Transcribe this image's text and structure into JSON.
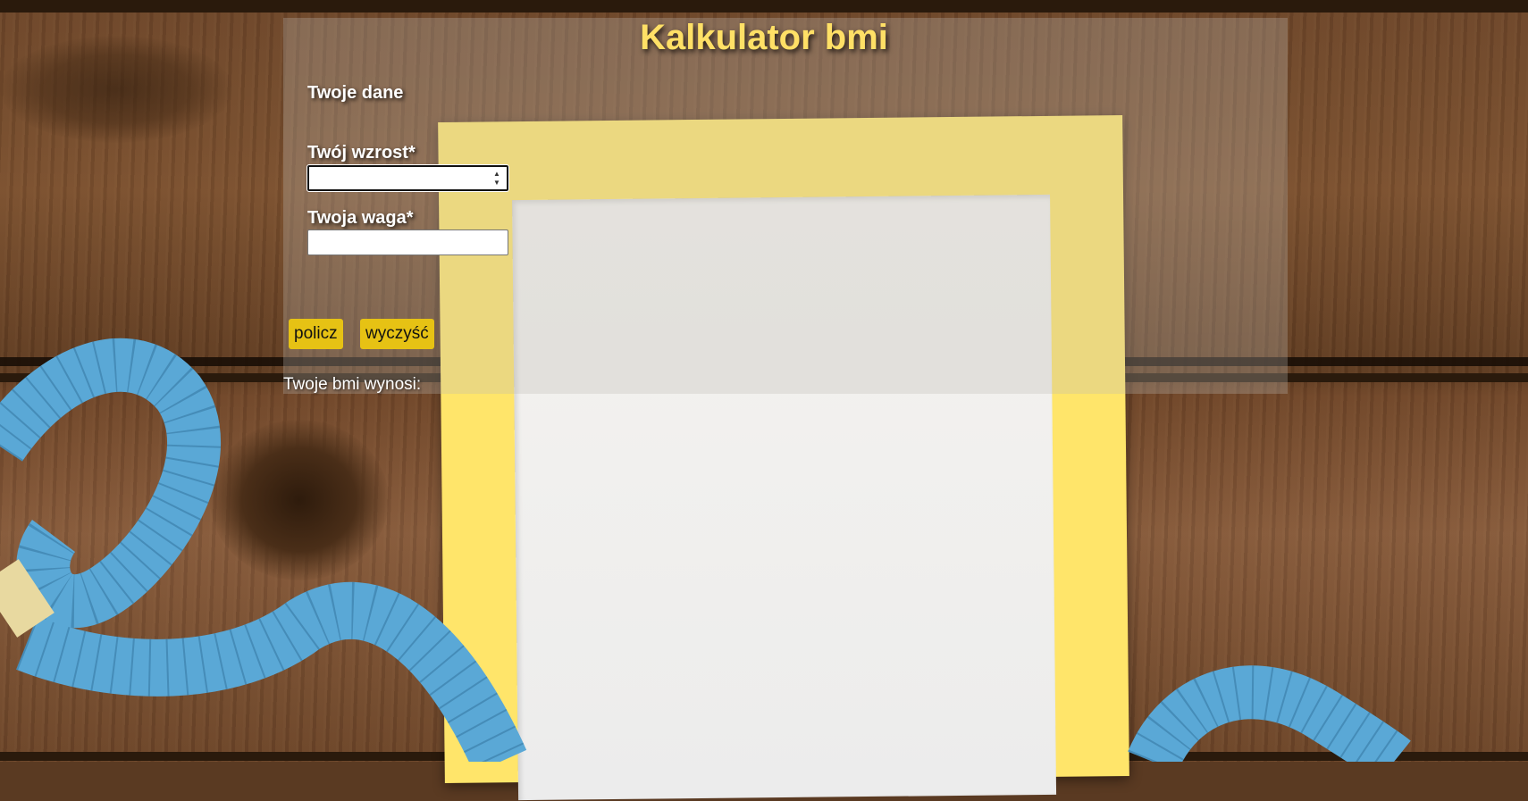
{
  "header": {
    "title": "Kalkulator bmi"
  },
  "form": {
    "section_title": "Twoje dane",
    "height": {
      "label": "Twój wzrost*",
      "value": "",
      "spin_up": "▲",
      "spin_down": "▼"
    },
    "weight": {
      "label": "Twoja waga*",
      "value": ""
    }
  },
  "actions": {
    "calculate_label": "policz",
    "clear_label": "wyczyść"
  },
  "result": {
    "label": "Twoje bmi wynosi:"
  },
  "colors": {
    "accent": "#e6c214",
    "title": "#ffe066",
    "frame": "#ffe56a",
    "tape": "#5aa8d6"
  },
  "icons": {
    "spin_up": "triangle-up-icon",
    "spin_down": "triangle-down-icon"
  }
}
